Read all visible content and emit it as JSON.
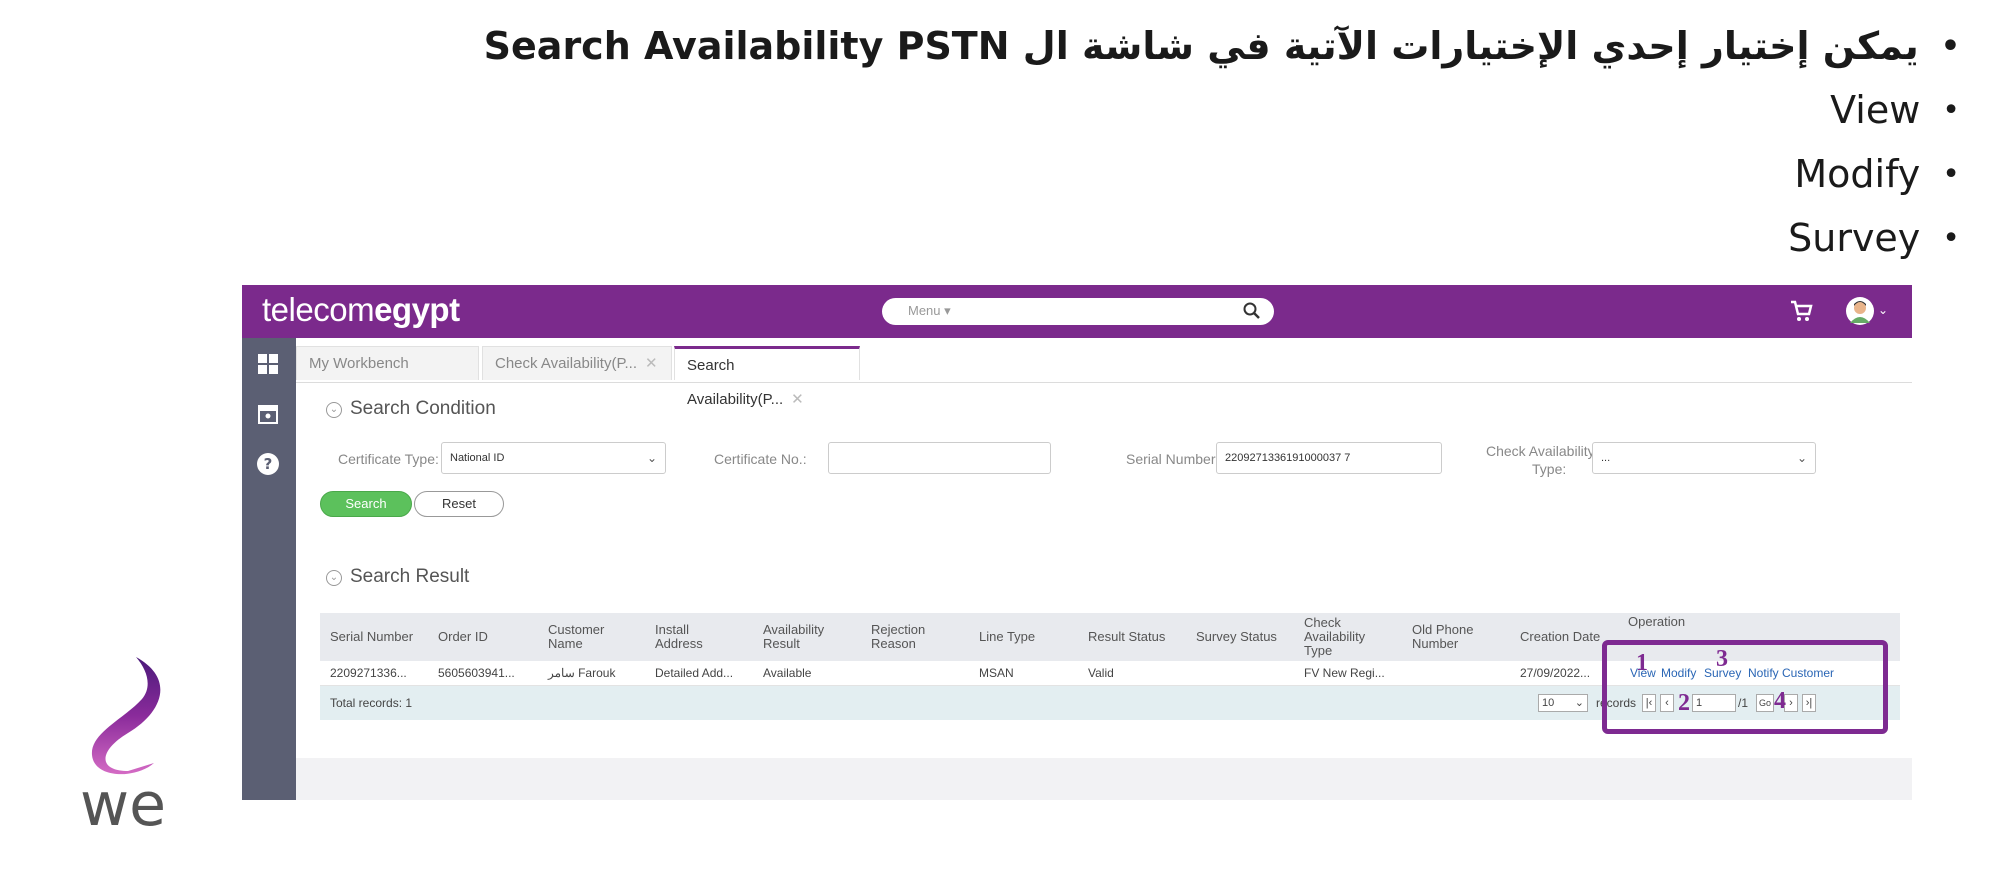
{
  "slide": {
    "heading": "يمكن إختيار إحدي الإختيارات الآتية في شاشة ال Search Availability PSTN",
    "options": [
      "View",
      "Modify",
      "Survey"
    ]
  },
  "app": {
    "logo_light": "tele",
    "logo_mid": "com",
    "logo_bold": "egypt",
    "menu_label": "Menu ▾",
    "brand_color": "#7b2a8c"
  },
  "tabs": [
    {
      "label": "My Workbench"
    },
    {
      "label": "Check Availability(P..."
    },
    {
      "label": "Search Availability(P..."
    }
  ],
  "search_condition": {
    "title": "Search Condition",
    "certificate_type_label": "Certificate Type:",
    "certificate_type_value": "National ID",
    "certificate_no_label": "Certificate No.:",
    "certificate_no_value": "",
    "serial_number_label": "Serial Number:",
    "serial_number_value": "2209271336191000037 7",
    "check_type_label_1": "Check Availability",
    "check_type_label_2": "Type:",
    "check_type_value": "...",
    "search_label": "Search",
    "reset_label": "Reset"
  },
  "search_result": {
    "title": "Search Result",
    "headers": {
      "serial": "Serial Number",
      "order": "Order ID",
      "customer_1": "Customer",
      "customer_2": "Name",
      "install_1": "Install",
      "install_2": "Address",
      "avail_1": "Availability",
      "avail_2": "Result",
      "rej_1": "Rejection",
      "rej_2": "Reason",
      "line": "Line Type",
      "result": "Result Status",
      "survey": "Survey Status",
      "check_1": "Check",
      "check_2": "Availability",
      "check_3": "Type",
      "old_1": "Old Phone",
      "old_2": "Number",
      "creation": "Creation Date",
      "operation": "Operation"
    },
    "row": {
      "serial": "2209271336...",
      "order": "5605603941...",
      "customer": "سامر Farouk",
      "install": "Detailed Add...",
      "availability": "Available",
      "rejection": "",
      "line_type": "MSAN",
      "result_status": "Valid",
      "survey_status": "",
      "check_type": "FV New Regi...",
      "old_phone": "",
      "creation": "27/09/2022...",
      "op_view": "View",
      "op_modify": "Modify",
      "op_survey": "Survey",
      "op_notify": "Notify Customer"
    },
    "total": "Total records: 1",
    "page_size": "10",
    "records_label": "records",
    "page_input": "1",
    "page_total": "/1",
    "go_label": "Go"
  },
  "annotations": [
    "1",
    "2",
    "3",
    "4"
  ],
  "annotation_color": "#7e2a91",
  "brand": {
    "we_text": "we"
  }
}
